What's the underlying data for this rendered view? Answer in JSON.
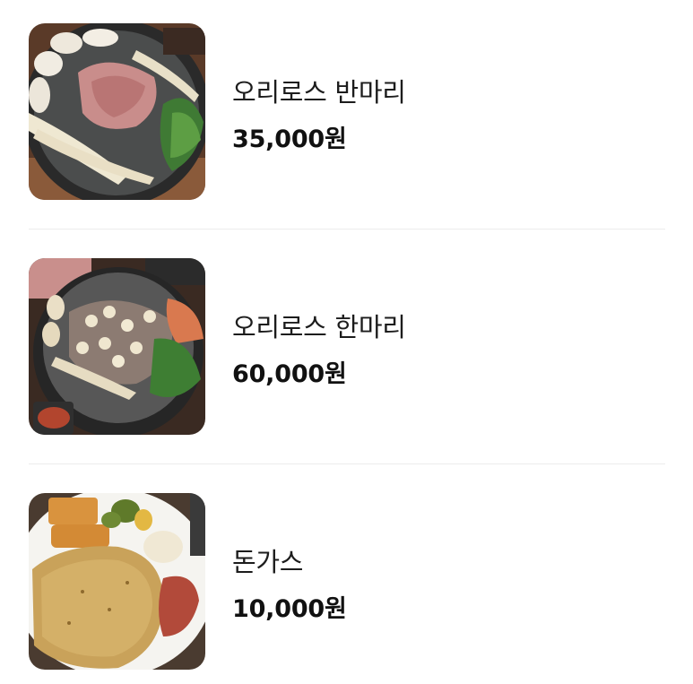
{
  "menu": {
    "items": [
      {
        "name": "오리로스 반마리",
        "price": "35,000원",
        "image": "duck-roast-half-photo"
      },
      {
        "name": "오리로스 한마리",
        "price": "60,000원",
        "image": "duck-roast-whole-photo"
      },
      {
        "name": "돈가스",
        "price": "10,000원",
        "image": "pork-cutlet-photo"
      }
    ]
  }
}
